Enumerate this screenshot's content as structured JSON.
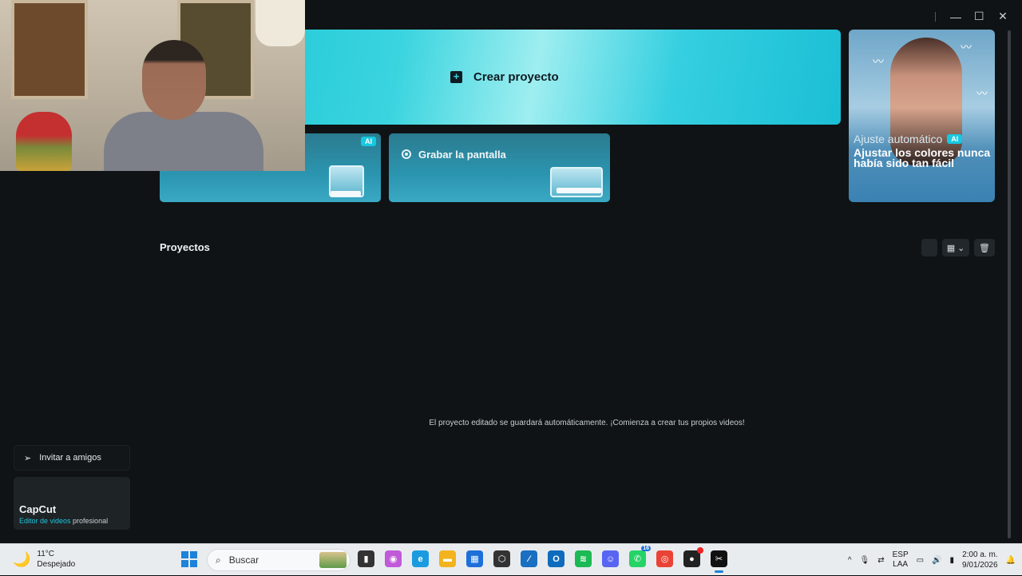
{
  "window": {
    "controls": [
      "—",
      "☐",
      "✕"
    ]
  },
  "hero": {
    "create_label": "Crear proyecto"
  },
  "cards": [
    {
      "label": "",
      "badge": "AI"
    },
    {
      "label": "Grabar la pantalla"
    }
  ],
  "promo": {
    "title": "Ajuste automático",
    "badge": "AI",
    "subtitle": "Ajustar los colores nunca había sido tan fácil"
  },
  "projects": {
    "title": "Proyectos",
    "empty_message": "El proyecto editado se guardará automáticamente. ¡Comienza a crear tus propios videos!"
  },
  "sidebar": {
    "invite_label": "Invitar a amigos",
    "brand_name": "CapCut",
    "brand_sub_highlight": "Editor de videos",
    "brand_sub_rest": " profesional"
  },
  "taskbar": {
    "weather_temp": "11°C",
    "weather_desc": "Despejado",
    "search_placeholder": "Buscar",
    "icons": [
      {
        "name": "file-explorer-dark",
        "color": "#333333",
        "glyph": "▮"
      },
      {
        "name": "copilot",
        "color": "#c05ad8",
        "glyph": "◉"
      },
      {
        "name": "edge",
        "color": "#1a9be0",
        "glyph": "e"
      },
      {
        "name": "folder",
        "color": "#f2b31f",
        "glyph": "▬"
      },
      {
        "name": "store",
        "color": "#1d6fd9",
        "glyph": "▦"
      },
      {
        "name": "unity",
        "color": "#333333",
        "glyph": "⬡"
      },
      {
        "name": "visual-studio",
        "color": "#1a6fc0",
        "glyph": "⁄"
      },
      {
        "name": "outlook",
        "color": "#0f6cbd",
        "glyph": "O"
      },
      {
        "name": "spotify",
        "color": "#1db954",
        "glyph": "≋"
      },
      {
        "name": "discord",
        "color": "#5865f2",
        "glyph": "☺"
      },
      {
        "name": "whatsapp",
        "color": "#25d366",
        "glyph": "✆",
        "badge": "16"
      },
      {
        "name": "chrome",
        "color": "#ea4335",
        "glyph": "◎"
      },
      {
        "name": "obs",
        "color": "#222222",
        "glyph": "●"
      },
      {
        "name": "capcut",
        "color": "#111111",
        "glyph": "✂"
      }
    ],
    "lang_top": "ESP",
    "lang_bottom": "LAA",
    "time": "2:00 a. m.",
    "date": "9/01/2026"
  }
}
